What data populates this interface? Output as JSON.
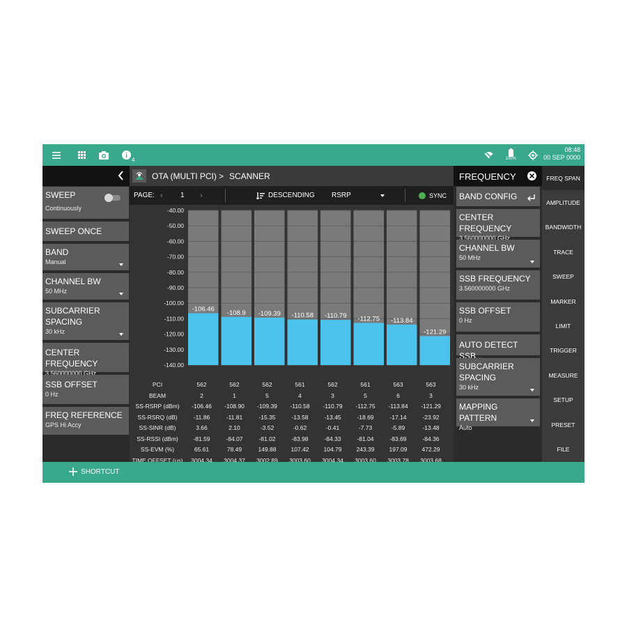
{
  "topbar": {
    "info_badge": "4",
    "battery": "100%",
    "time": "08:48",
    "date": "00 SEP 0000"
  },
  "left_panel": [
    {
      "title": "SWEEP",
      "value": "Continuously",
      "control": "toggle"
    },
    {
      "title": "SWEEP ONCE",
      "value": "",
      "control": "button"
    },
    {
      "title": "BAND",
      "value": "Manual",
      "control": "dropdown"
    },
    {
      "title": "CHANNEL BW",
      "value": "50 MHz",
      "control": "dropdown"
    },
    {
      "title": "SUBCARRIER SPACING",
      "value": "30 kHz",
      "control": "dropdown"
    },
    {
      "title": "CENTER FREQUENCY",
      "value": "3.560000000 GHz",
      "control": "field"
    },
    {
      "title": "SSB OFFSET",
      "value": "0 Hz",
      "control": "field"
    },
    {
      "title": "FREQ REFERENCE",
      "value": "GPS Hi Accy",
      "control": "field"
    }
  ],
  "breadcrumb": {
    "mode": "OTA (MULTI PCI)",
    "separator": ">",
    "view": "SCANNER"
  },
  "toolbar": {
    "page_label": "PAGE:",
    "page_number": "1",
    "sort_label": "DESCENDING",
    "sort_by": "RSRP",
    "sync_label": "SYNC",
    "sync_color": "#4caf50"
  },
  "chart_data": {
    "type": "bar",
    "bar_color": "#4cc3ec",
    "ylim": [
      -140,
      -40
    ],
    "yticks": [
      "-40.00",
      "-50.00",
      "-60.00",
      "-70.00",
      "-80.00",
      "-90.00",
      "-100.00",
      "-110.00",
      "-120.00",
      "-130.00",
      "-140.00"
    ],
    "values": [
      -106.46,
      -108.9,
      -109.39,
      -110.58,
      -110.79,
      -112.75,
      -113.84,
      -121.29
    ],
    "labels": [
      "-106.46",
      "-108.9",
      "-109.39",
      "-110.58",
      "-110.79",
      "-112.75",
      "-113.84",
      "-121.29"
    ]
  },
  "table": {
    "rows": [
      {
        "label": "PCI",
        "values": [
          "562",
          "562",
          "562",
          "561",
          "562",
          "561",
          "563",
          "563"
        ]
      },
      {
        "label": "BEAM",
        "values": [
          "2",
          "1",
          "5",
          "4",
          "3",
          "5",
          "6",
          "3"
        ]
      },
      {
        "label": "SS-RSRP (dBm)",
        "values": [
          "-106.46",
          "-108.90",
          "-109.39",
          "-110.58",
          "-110.79",
          "-112.75",
          "-113.84",
          "-121.29"
        ]
      },
      {
        "label": "SS-RSRQ (dB)",
        "values": [
          "-11.86",
          "-11.81",
          "-15.35",
          "-13.58",
          "-13.45",
          "-18.69",
          "-17.14",
          "-23.92"
        ]
      },
      {
        "label": "SS-SINR (dB)",
        "values": [
          "3.66",
          "2.10",
          "-3.52",
          "-0.62",
          "-0.41",
          "-7.73",
          "-5.89",
          "-13.48"
        ]
      },
      {
        "label": "SS-RSSI (dBm)",
        "values": [
          "-81.59",
          "-84.07",
          "-81.02",
          "-83.98",
          "-84.33",
          "-81.04",
          "-83.69",
          "-84.36"
        ]
      },
      {
        "label": "SS-EVM (%)",
        "values": [
          "65.61",
          "78.49",
          "149.88",
          "107.42",
          "104.79",
          "243.39",
          "197.09",
          "472.29"
        ]
      },
      {
        "label": "TIME OFFSET (µs)",
        "values": [
          "3004.34",
          "3004.37",
          "3002.89",
          "3003.60",
          "3004.34",
          "3003.60",
          "3003.78",
          "3003.68"
        ]
      }
    ]
  },
  "right_panel": {
    "title": "FREQUENCY",
    "items": [
      {
        "title": "BAND CONFIG",
        "value": "",
        "control": "enter"
      },
      {
        "title": "CENTER FREQUENCY",
        "value": "3.560000000 GHz",
        "control": "field"
      },
      {
        "title": "CHANNEL BW",
        "value": "50 MHz",
        "control": "dropdown"
      },
      {
        "title": "SSB FREQUENCY",
        "value": "3.560000000 GHz",
        "control": "field"
      },
      {
        "title": "SSB OFFSET",
        "value": "0 Hz",
        "control": "field"
      },
      {
        "title": "AUTO DETECT SSB...",
        "value": "",
        "control": "button"
      },
      {
        "title": "SUBCARRIER SPACING",
        "value": "30 kHz",
        "control": "dropdown"
      },
      {
        "title": "MAPPING PATTERN",
        "value": "Auto",
        "control": "dropdown"
      }
    ]
  },
  "menu": [
    "FREQ SPAN",
    "AMPLITUDE",
    "BANDWIDTH",
    "TRACE",
    "SWEEP",
    "MARKER",
    "LIMIT",
    "TRIGGER",
    "MEASURE",
    "SETUP",
    "PRESET",
    "FILE"
  ],
  "menu_active": "FREQ SPAN",
  "bottombar": {
    "shortcut_label": "SHORTCUT"
  },
  "colors": {
    "accent": "#3aa88c",
    "bar": "#4cc3ec",
    "panel_item": "#5b5b5b"
  }
}
